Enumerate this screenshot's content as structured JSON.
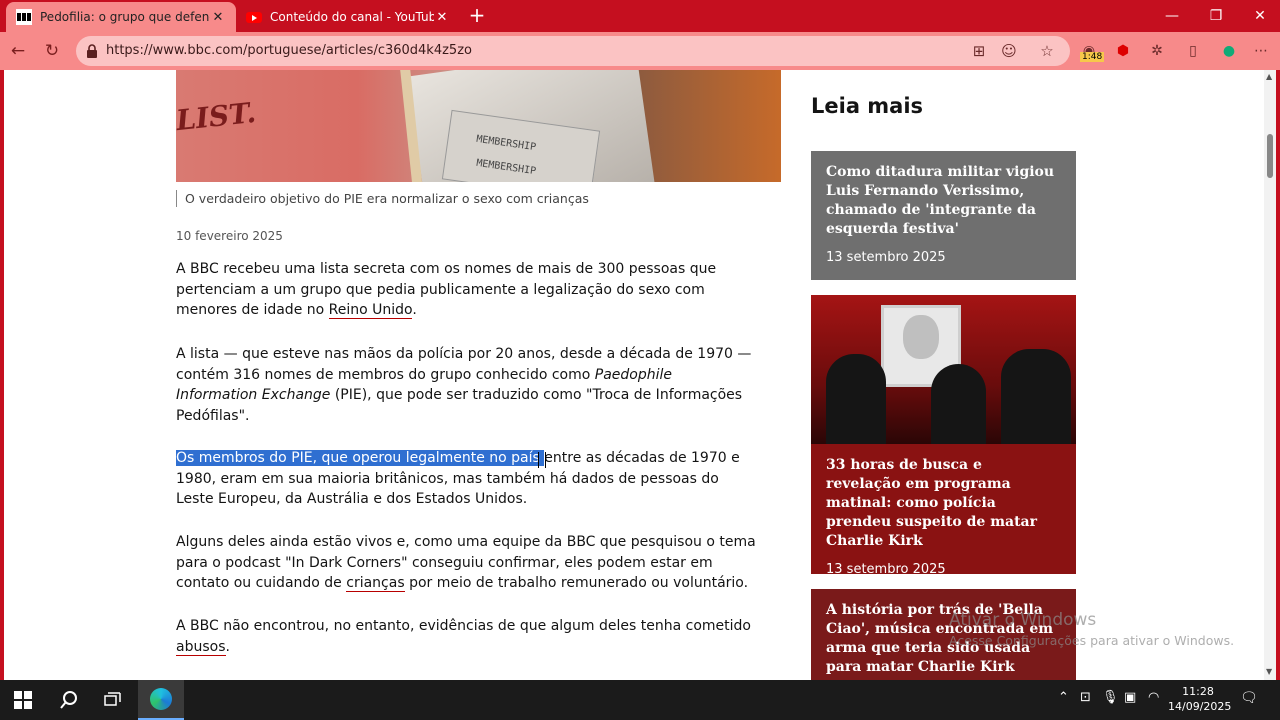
{
  "browser": {
    "tabs": [
      {
        "title": "Pedofilia: o grupo que defendia s",
        "active": true
      },
      {
        "title": "Conteúdo do canal - YouTube Stu",
        "active": false
      }
    ],
    "url": "https://www.bbc.com/portuguese/articles/c360d4k4z5zo",
    "extension_badge": "1:48",
    "accent": "#c50f1f"
  },
  "article": {
    "hero_text": {
      "list": "LIST.",
      "membership1": "MEMBERSHIP",
      "membership2": "MEMBERSHIP"
    },
    "caption": "O verdadeiro objetivo do PIE era normalizar o sexo com crianças",
    "date": "10 fevereiro 2025",
    "p1": {
      "text": "A BBC recebeu uma lista secreta com os nomes de mais de 300 pessoas que pertenciam a um grupo que pedia publicamente a legalização do sexo com menores de idade no ",
      "link": "Reino Unido",
      "end": "."
    },
    "p2": {
      "text1": "A lista — que esteve nas mãos da polícia por 20 anos, desde a década de 1970 — contém 316 nomes de membros do grupo conhecido como ",
      "italic": "Paedophile Information Exchange",
      "text2": " (PIE), que pode ser traduzido como \"Troca de Informações Pedófilas\"."
    },
    "p3": {
      "highlight": "Os membros do PIE, que operou legalmente no país ",
      "text": "entre as décadas de 1970 e 1980, eram em sua maioria britânicos, mas também há dados de pessoas do Leste Europeu, da Austrália e dos Estados Unidos."
    },
    "p4": {
      "text1": "Alguns deles ainda estão vivos e, como uma equipe da BBC que pesquisou o tema para o podcast \"In Dark Corners\" conseguiu confirmar, eles podem estar em contato ou cuidando de ",
      "link": "crianças",
      "text2": " por meio de trabalho remunerado ou voluntário."
    },
    "p5": {
      "text": "A BBC não encontrou, no entanto, evidências de que algum deles tenha cometido ",
      "link": "abusos",
      "end": "."
    }
  },
  "sidebar": {
    "title": "Leia mais",
    "cards": [
      {
        "title": "Como ditadura militar vigiou Luis Fernando Verissimo, chamado de 'integrante da esquerda festiva'",
        "date": "13 setembro 2025"
      },
      {
        "title": "33 horas de busca e revelação em programa matinal: como polícia prendeu suspeito de matar Charlie Kirk",
        "date": "13 setembro 2025"
      },
      {
        "title": "A história por trás de 'Bella Ciao', música encontrada em arma que teria sido usada para matar Charlie Kirk",
        "date": ""
      }
    ]
  },
  "watermark": {
    "line1": "Ativar o Windows",
    "line2": "Acesse Configurações para ativar o Windows."
  },
  "taskbar": {
    "time": "11:28",
    "date": "14/09/2025"
  }
}
